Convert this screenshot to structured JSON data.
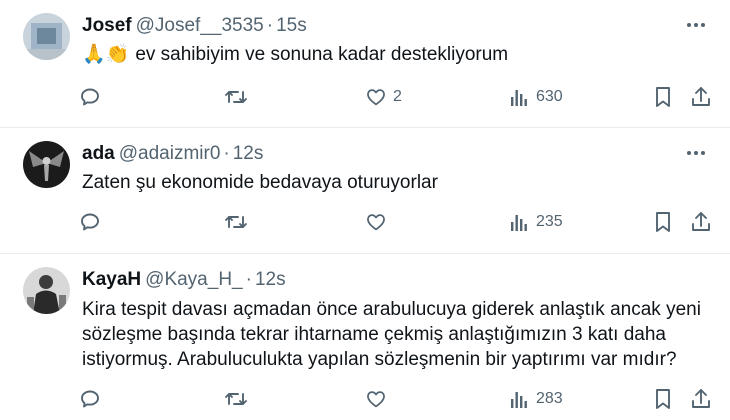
{
  "tweets": [
    {
      "name": "Josef",
      "handle": "@Josef__3535",
      "separator": "·",
      "time": "15s",
      "emoji": "🙏👏",
      "text": "ev sahibiyim ve sonuna kadar destekliyorum",
      "likes": "2",
      "views": "630"
    },
    {
      "name": "ada",
      "handle": "@adaizmir0",
      "separator": "·",
      "time": "12s",
      "text": "Zaten şu ekonomide bedavaya oturuyorlar",
      "likes": "",
      "views": "235"
    },
    {
      "name": "KayaH",
      "handle": "@Kaya_H_",
      "separator": "·",
      "time": "12s",
      "text": "Kira tespit davası açmadan önce arabulucuya giderek anlaştık ancak yeni sözleşme başında tekrar ihtarname çekmiş anlaştığımızın 3 katı daha istiyormuş. Arabuluculukta yapılan sözleşmenin bir yaptırımı var mıdır?",
      "likes": "",
      "views": "283"
    }
  ],
  "icons": {
    "reply": "reply-icon",
    "retweet": "retweet-icon",
    "like": "heart-icon",
    "views": "views-icon",
    "bookmark": "bookmark-icon",
    "share": "share-icon",
    "more": "more-icon"
  },
  "colors": {
    "text": "#0f1419",
    "secondary": "#536471",
    "divider": "#e6ecf0"
  }
}
